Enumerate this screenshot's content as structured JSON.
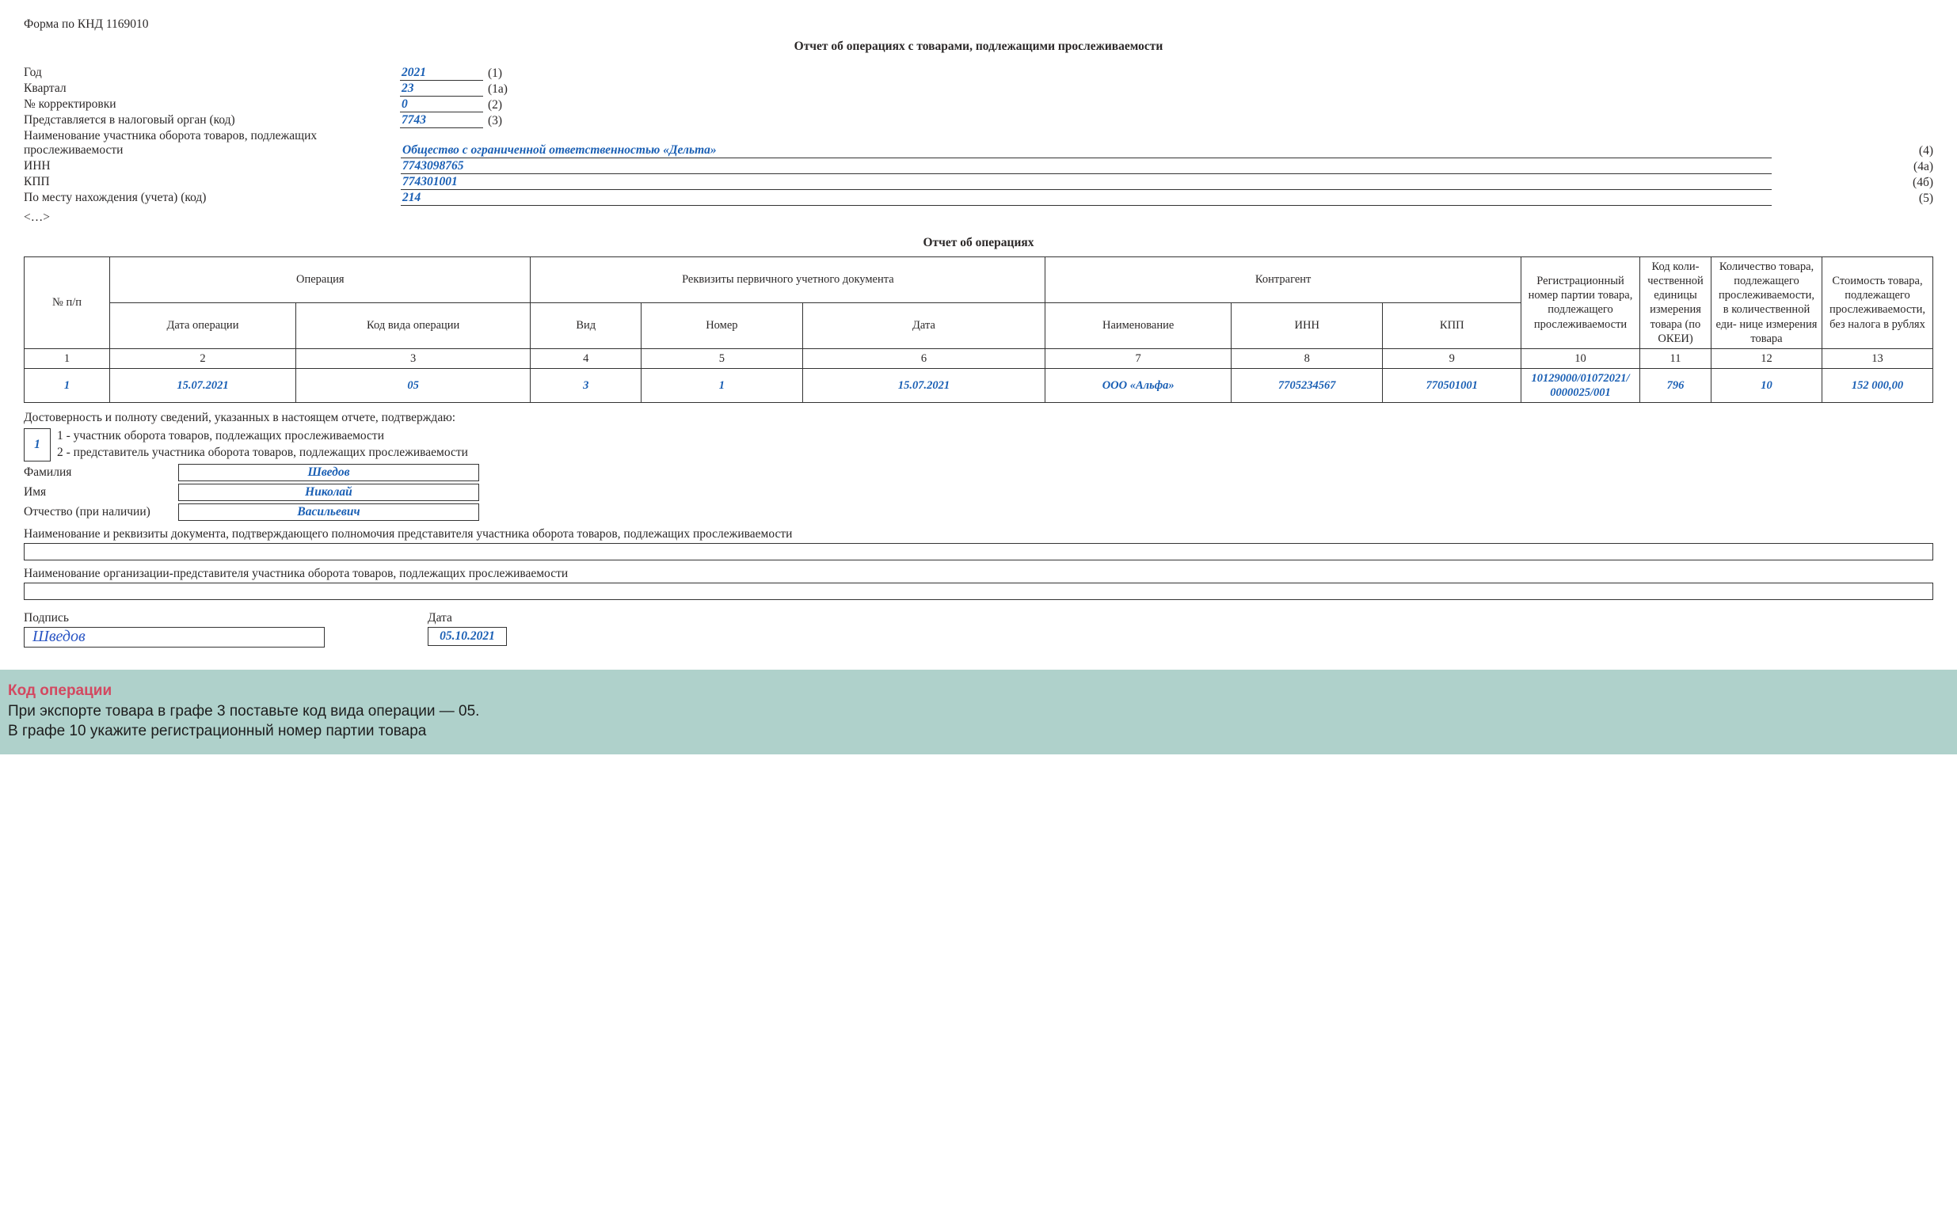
{
  "form_code": "Форма по КНД 1169010",
  "title": "Отчет об операциях с товарами, подлежащими прослеживаемости",
  "header": {
    "year": {
      "label": "Год",
      "value": "2021",
      "code": "(1)"
    },
    "quarter": {
      "label": "Квартал",
      "value": "23",
      "code": "(1а)"
    },
    "corr": {
      "label": "№ корректировки",
      "value": "0",
      "code": "(2)"
    },
    "tax_org": {
      "label": "Представляется в налоговый орган (код)",
      "value": "7743",
      "code": "(3)"
    },
    "name": {
      "label": "Наименование участника оборота товаров, подлежащих прослеживаемости",
      "value": "Общество с ограниченной ответственностью «Дельта»",
      "code": "(4)"
    },
    "inn": {
      "label": "ИНН",
      "value": "7743098765",
      "code": "(4а)"
    },
    "kpp": {
      "label": "КПП",
      "value": "774301001",
      "code": "(4б)"
    },
    "location": {
      "label": "По месту нахождения (учета) (код)",
      "value": "214",
      "code": "(5)"
    },
    "truncated": "<…>"
  },
  "section_title": "Отчет об операциях",
  "table": {
    "headers": {
      "npp": "№ п/п",
      "operation": "Операция",
      "date_op": "Дата операции",
      "op_code": "Код вида операции",
      "primary_doc": "Реквизиты первичного учетного документа",
      "pd_type": "Вид",
      "pd_num": "Номер",
      "pd_date": "Дата",
      "counterparty": "Контрагент",
      "cp_name": "Наименование",
      "cp_inn": "ИНН",
      "cp_kpp": "КПП",
      "reg_num": "Регистрационный номер партии товара, подлежащего прослеживаемости",
      "okei": "Код коли- чественной единицы измерения товара (по ОКЕИ)",
      "qty": "Количество товара, подлежащего прослеживаемости, в количественной еди- нице измерения товара",
      "cost": "Стоимость товара, подлежащего прослеживаемости, без налога в рублях"
    },
    "numrow": [
      "1",
      "2",
      "3",
      "4",
      "5",
      "6",
      "7",
      "8",
      "9",
      "10",
      "11",
      "12",
      "13"
    ],
    "data": {
      "npp": "1",
      "date_op": "15.07.2021",
      "op_code": "05",
      "pd_type": "3",
      "pd_num": "1",
      "pd_date": "15.07.2021",
      "cp_name": "ООО «Альфа»",
      "cp_inn": "7705234567",
      "cp_kpp": "770501001",
      "reg_num": "10129000/01072021/ 0000025/001",
      "okei": "796",
      "qty": "10",
      "cost": "152 000,00"
    }
  },
  "confirm_line": "Достоверность и полноту сведений, указанных в настоящем отчете, подтверждаю:",
  "signer": {
    "code": "1",
    "opt1": "1 - участник оборота товаров, подлежащих прослеживаемости",
    "opt2": "2 - представитель участника оборота товаров, подлежащих прослеживаемости",
    "lastname_label": "Фамилия",
    "lastname": "Шведов",
    "firstname_label": "Имя",
    "firstname": "Николай",
    "patronymic_label": "Отчество (при наличии)",
    "patronymic": "Васильевич"
  },
  "rep_doc_label": "Наименование и реквизиты документа, подтверждающего полномочия представителя участника оборота товаров, подлежащих прослеживаемости",
  "rep_org_label": "Наименование организации-представителя участника оборота товаров, подлежащих прослеживаемости",
  "signature_label": "Подпись",
  "signature_value": "Шведов",
  "date_label": "Дата",
  "date_value": "05.10.2021",
  "caption": {
    "title": "Код операции",
    "line1": "При экспорте товара в графе 3 поставьте код вида операции — 05.",
    "line2": "В графе 10 укажите регистрационный номер партии товара"
  }
}
